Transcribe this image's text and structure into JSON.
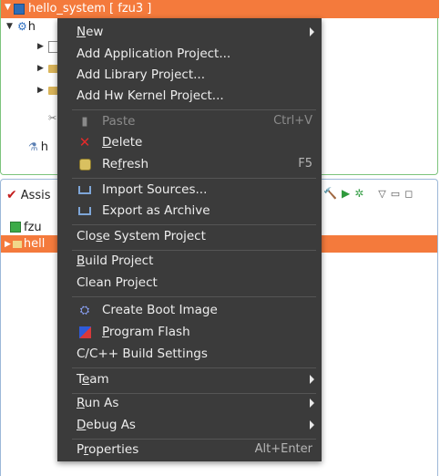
{
  "explorer": {
    "selected_project": "hello_system [ fzu3 ]",
    "child_label_1": "h",
    "child_label_2": "h"
  },
  "assistant": {
    "title": "Assis",
    "row1": "fzu",
    "row2": "hell"
  },
  "menu": {
    "new": "New",
    "add_application": "Add Application Project...",
    "add_library": "Add Library Project...",
    "add_hw_kernel": "Add Hw Kernel Project...",
    "paste": "Paste",
    "paste_accel": "Ctrl+V",
    "delete": "Delete",
    "refresh": "Refresh",
    "refresh_accel": "F5",
    "import_sources": "Import Sources...",
    "export_archive": "Export as Archive",
    "close_system": "Close System Project",
    "build": "Build Project",
    "clean": "Clean Project",
    "create_boot": "Create Boot Image",
    "program_flash": "Program Flash",
    "build_settings": "C/C++ Build Settings",
    "team": "Team",
    "run_as": "Run As",
    "debug_as": "Debug As",
    "properties": "Properties",
    "properties_accel": "Alt+Enter"
  },
  "colors": {
    "menu_bg": "#3b3b3b",
    "selection": "#f47a3c",
    "menu_text": "#ededed"
  }
}
